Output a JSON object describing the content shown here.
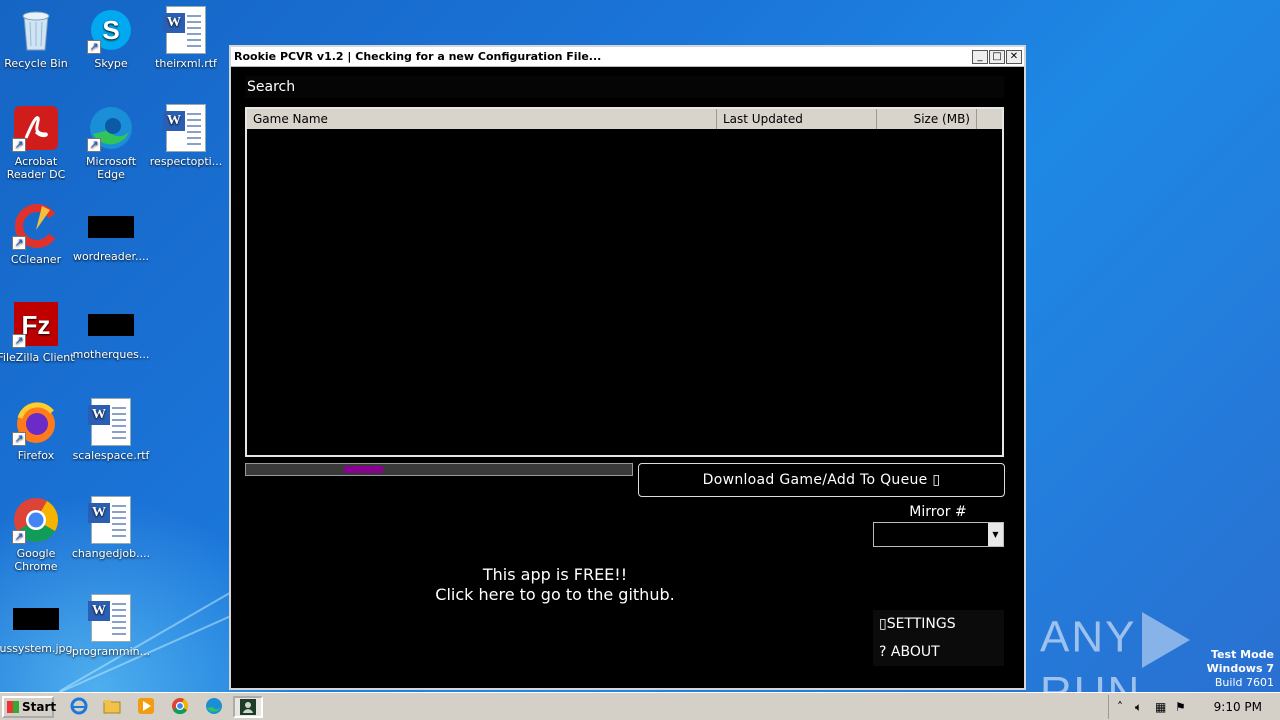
{
  "desktop": {
    "icons": [
      {
        "label": "Recycle Bin",
        "icon": "recycle-bin-icon"
      },
      {
        "label": "Skype",
        "icon": "skype-icon"
      },
      {
        "label": "theirxml.rtf",
        "icon": "word-document-icon"
      },
      {
        "label": "Acrobat Reader DC",
        "icon": "acrobat-reader-icon"
      },
      {
        "label": "Microsoft Edge",
        "icon": "edge-icon"
      },
      {
        "label": "respectopti...",
        "icon": "word-document-icon"
      },
      {
        "label": "CCleaner",
        "icon": "ccleaner-icon"
      },
      {
        "label": "wordreader....",
        "icon": "black-thumbnail-icon"
      },
      {
        "label": "FileZilla Client",
        "icon": "filezilla-icon"
      },
      {
        "label": "motherques...",
        "icon": "black-thumbnail-icon"
      },
      {
        "label": "Firefox",
        "icon": "firefox-icon"
      },
      {
        "label": "scalespace.rtf",
        "icon": "word-document-icon"
      },
      {
        "label": "Google Chrome",
        "icon": "chrome-icon"
      },
      {
        "label": "changedjob....",
        "icon": "word-document-icon"
      },
      {
        "label": "ussystem.jpg",
        "icon": "black-thumbnail-icon"
      },
      {
        "label": "programmin...",
        "icon": "word-document-icon"
      }
    ]
  },
  "window": {
    "title": "Rookie PCVR v1.2 | Checking for a new Configuration File...",
    "controls": {
      "minimize": "_",
      "maximize": "□",
      "close": "✕"
    }
  },
  "app": {
    "search_placeholder": "Search",
    "columns": {
      "name": "Game Name",
      "updated": "Last Updated",
      "size": "Size (MB)"
    },
    "rows": [],
    "download_button": "Download Game/Add To Queue ▯",
    "mirror_label": "Mirror #",
    "mirror_value": "",
    "free_line1": "This app is FREE!!",
    "free_line2": "Click here to go to the github.",
    "menu": {
      "settings": "▯SETTINGS",
      "about": "?   ABOUT"
    }
  },
  "watermark": {
    "brand_left": "ANY",
    "brand_right": "RUN",
    "mode": "Test Mode",
    "os": "Windows 7",
    "build": "Build 7601"
  },
  "taskbar": {
    "start": "Start",
    "clock": "9:10 PM"
  },
  "colors": {
    "progress_fill": "#8a0090",
    "desktop_blue": "#1b74d8"
  }
}
